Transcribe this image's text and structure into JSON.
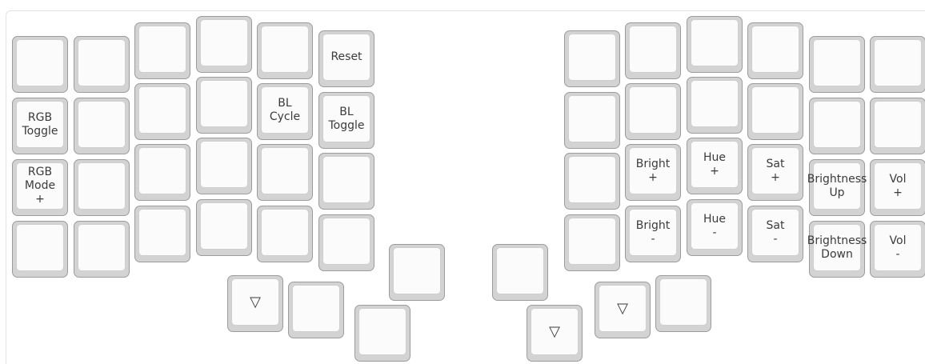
{
  "keyboard": {
    "keys": [
      {
        "id": "l00",
        "legend": ""
      },
      {
        "id": "l01",
        "legend": ""
      },
      {
        "id": "l02",
        "legend": ""
      },
      {
        "id": "l03",
        "legend": ""
      },
      {
        "id": "l04",
        "legend": ""
      },
      {
        "id": "l05",
        "legend": "Reset"
      },
      {
        "id": "l10",
        "legend": "RGB\nToggle"
      },
      {
        "id": "l11",
        "legend": ""
      },
      {
        "id": "l12",
        "legend": ""
      },
      {
        "id": "l13",
        "legend": ""
      },
      {
        "id": "l14",
        "legend": "BL\nCycle"
      },
      {
        "id": "l15",
        "legend": "BL\nToggle"
      },
      {
        "id": "l20",
        "legend": "RGB\nMode\n+"
      },
      {
        "id": "l21",
        "legend": ""
      },
      {
        "id": "l22",
        "legend": ""
      },
      {
        "id": "l23",
        "legend": ""
      },
      {
        "id": "l24",
        "legend": ""
      },
      {
        "id": "l25",
        "legend": ""
      },
      {
        "id": "l30",
        "legend": ""
      },
      {
        "id": "l31",
        "legend": ""
      },
      {
        "id": "l32",
        "legend": ""
      },
      {
        "id": "l33",
        "legend": ""
      },
      {
        "id": "l34",
        "legend": ""
      },
      {
        "id": "l35",
        "legend": ""
      },
      {
        "id": "lt0",
        "legend": "▽"
      },
      {
        "id": "lt1",
        "legend": ""
      },
      {
        "id": "lt2",
        "legend": ""
      },
      {
        "id": "lt3",
        "legend": ""
      },
      {
        "id": "r00",
        "legend": ""
      },
      {
        "id": "r01",
        "legend": ""
      },
      {
        "id": "r02",
        "legend": ""
      },
      {
        "id": "r03",
        "legend": ""
      },
      {
        "id": "r04",
        "legend": ""
      },
      {
        "id": "r05",
        "legend": ""
      },
      {
        "id": "r10",
        "legend": ""
      },
      {
        "id": "r11",
        "legend": ""
      },
      {
        "id": "r12",
        "legend": ""
      },
      {
        "id": "r13",
        "legend": ""
      },
      {
        "id": "r14",
        "legend": ""
      },
      {
        "id": "r15",
        "legend": ""
      },
      {
        "id": "r20",
        "legend": ""
      },
      {
        "id": "r21",
        "legend": "Bright\n+"
      },
      {
        "id": "r22",
        "legend": "Hue\n+"
      },
      {
        "id": "r23",
        "legend": "Sat\n+"
      },
      {
        "id": "r24",
        "legend": "Brightness\nUp"
      },
      {
        "id": "r25",
        "legend": "Vol\n+"
      },
      {
        "id": "r30",
        "legend": ""
      },
      {
        "id": "r31",
        "legend": "Bright\n-"
      },
      {
        "id": "r32",
        "legend": "Hue\n-"
      },
      {
        "id": "r33",
        "legend": "Sat\n-"
      },
      {
        "id": "r34",
        "legend": "Brightness\nDown"
      },
      {
        "id": "r35",
        "legend": "Vol\n-"
      },
      {
        "id": "rt0",
        "legend": ""
      },
      {
        "id": "rt1",
        "legend": "▽"
      },
      {
        "id": "rt2",
        "legend": "▽"
      },
      {
        "id": "rt3",
        "legend": ""
      }
    ]
  }
}
